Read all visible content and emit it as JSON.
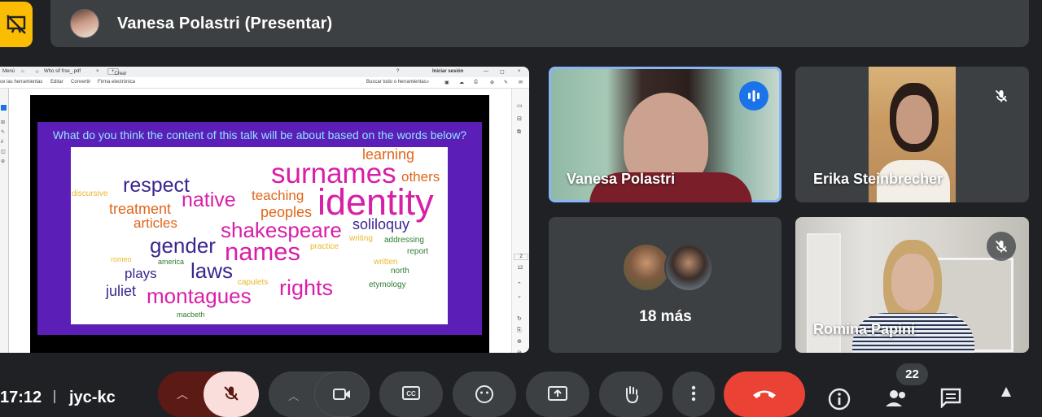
{
  "presentation": {
    "title": "Vanesa Polastri (Presentar)"
  },
  "browser": {
    "menu_label": "Menú",
    "tab_title": "Who sif frse_.pdf",
    "new_tab_label": "Crear",
    "signin_label": "Iniciar sesión",
    "toolbar": [
      "ce las herramientas",
      "Editar",
      "Convertir",
      "Firma electrónica"
    ],
    "search_tools": "Buscar todo o herramientas",
    "page_numbers": [
      "2",
      "12"
    ]
  },
  "slide": {
    "question": "What do you think the content of this talk will be about based on the words below?",
    "words": [
      {
        "text": "surnames",
        "color": "#d81fa8"
      },
      {
        "text": "identity",
        "color": "#d81fa8"
      },
      {
        "text": "respect",
        "color": "#3b2590"
      },
      {
        "text": "native",
        "color": "#d81fa8"
      },
      {
        "text": "teaching",
        "color": "#e0661b"
      },
      {
        "text": "learning",
        "color": "#e0661b"
      },
      {
        "text": "others",
        "color": "#e0661b"
      },
      {
        "text": "discursive",
        "color": "#e9b82a"
      },
      {
        "text": "treatment",
        "color": "#e0661b"
      },
      {
        "text": "peoples",
        "color": "#e0661b"
      },
      {
        "text": "articles",
        "color": "#e0661b"
      },
      {
        "text": "shakespeare",
        "color": "#d81fa8"
      },
      {
        "text": "soliloquy",
        "color": "#3b2590"
      },
      {
        "text": "writing",
        "color": "#e9b82a"
      },
      {
        "text": "addressing",
        "color": "#2e7d32"
      },
      {
        "text": "gender",
        "color": "#3b2590"
      },
      {
        "text": "names",
        "color": "#d81fa8"
      },
      {
        "text": "practice",
        "color": "#e9b82a"
      },
      {
        "text": "report",
        "color": "#2e7d32"
      },
      {
        "text": "romeo",
        "color": "#e9b82a"
      },
      {
        "text": "america",
        "color": "#2e7d32"
      },
      {
        "text": "written",
        "color": "#e9b82a"
      },
      {
        "text": "laws",
        "color": "#3b2590"
      },
      {
        "text": "plays",
        "color": "#3b2590"
      },
      {
        "text": "north",
        "color": "#2e7d32"
      },
      {
        "text": "capulets",
        "color": "#e9b82a"
      },
      {
        "text": "juliet",
        "color": "#3b2590"
      },
      {
        "text": "rights",
        "color": "#d81fa8"
      },
      {
        "text": "etymology",
        "color": "#2e7d32"
      },
      {
        "text": "montagues",
        "color": "#d81fa8"
      },
      {
        "text": "macbeth",
        "color": "#2e7d32"
      }
    ]
  },
  "participants": [
    {
      "name": "Vanesa Polastri",
      "state": "speaking"
    },
    {
      "name": "Erika Steinbrecher",
      "state": "muted"
    },
    {
      "name": "Romina Papini",
      "state": "muted"
    }
  ],
  "more_participants": "18 más",
  "footer": {
    "time": "17:12",
    "meeting_code": "jyc-kc",
    "participant_count": "22"
  },
  "colors": {
    "background": "#202124",
    "surface": "#3c4043",
    "accent_blue": "#1a73e8",
    "present_yellow": "#fbbc04",
    "end_call_red": "#ea4335",
    "slide_purple": "#5b1fb8"
  }
}
